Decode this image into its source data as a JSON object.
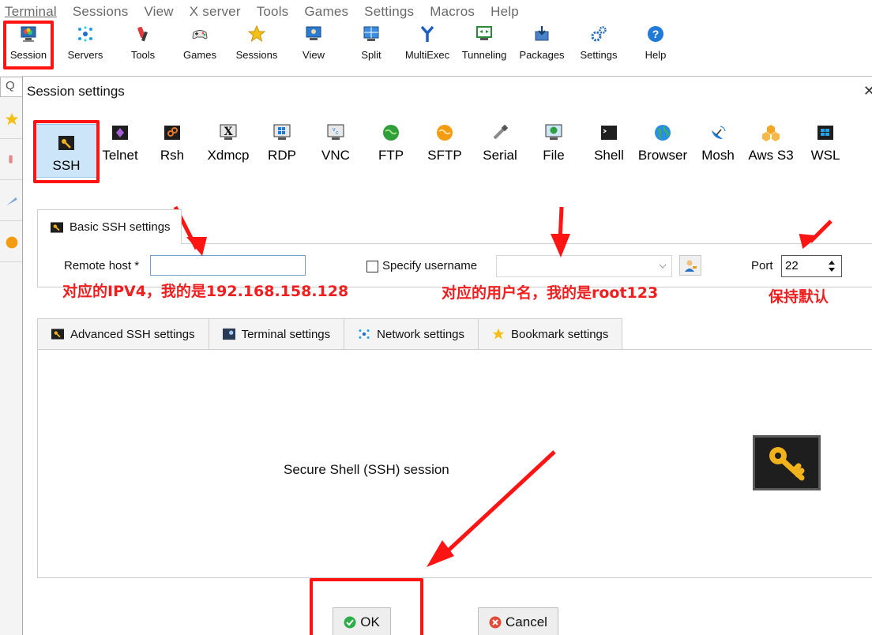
{
  "menubar": [
    "Terminal",
    "Sessions",
    "View",
    "X server",
    "Tools",
    "Games",
    "Settings",
    "Macros",
    "Help"
  ],
  "toolbar": {
    "items": [
      "Session",
      "Servers",
      "Tools",
      "Games",
      "Sessions",
      "View",
      "Split",
      "MultiExec",
      "Tunneling",
      "Packages",
      "Settings",
      "Help"
    ]
  },
  "sidebar": {
    "search_glyph": "Q"
  },
  "dialog": {
    "title": "Session settings",
    "close_glyph": "✕",
    "session_types": [
      "SSH",
      "Telnet",
      "Rsh",
      "Xdmcp",
      "RDP",
      "VNC",
      "FTP",
      "SFTP",
      "Serial",
      "File",
      "Shell",
      "Browser",
      "Mosh",
      "Aws S3",
      "WSL"
    ],
    "selected_type": "SSH",
    "basic_tab": "Basic SSH settings",
    "remote_host_label": "Remote host *",
    "remote_host_value": "",
    "specify_username_label": "Specify username",
    "specify_username_checked": false,
    "username_value": "",
    "port_label": "Port",
    "port_value": "22",
    "annotations": {
      "host": "对应的IPV4，我的是192.168.158.128",
      "username": "对应的用户名，我的是root123",
      "port": "保持默认"
    },
    "lower_tabs": [
      "Advanced SSH settings",
      "Terminal settings",
      "Network settings",
      "Bookmark settings"
    ],
    "description": "Secure Shell (SSH) session",
    "ok_label": "OK",
    "cancel_label": "Cancel"
  },
  "colors": {
    "highlight": "#ff1414",
    "annotation": "#f01e1e",
    "selected_bg": "#cde5f8"
  }
}
